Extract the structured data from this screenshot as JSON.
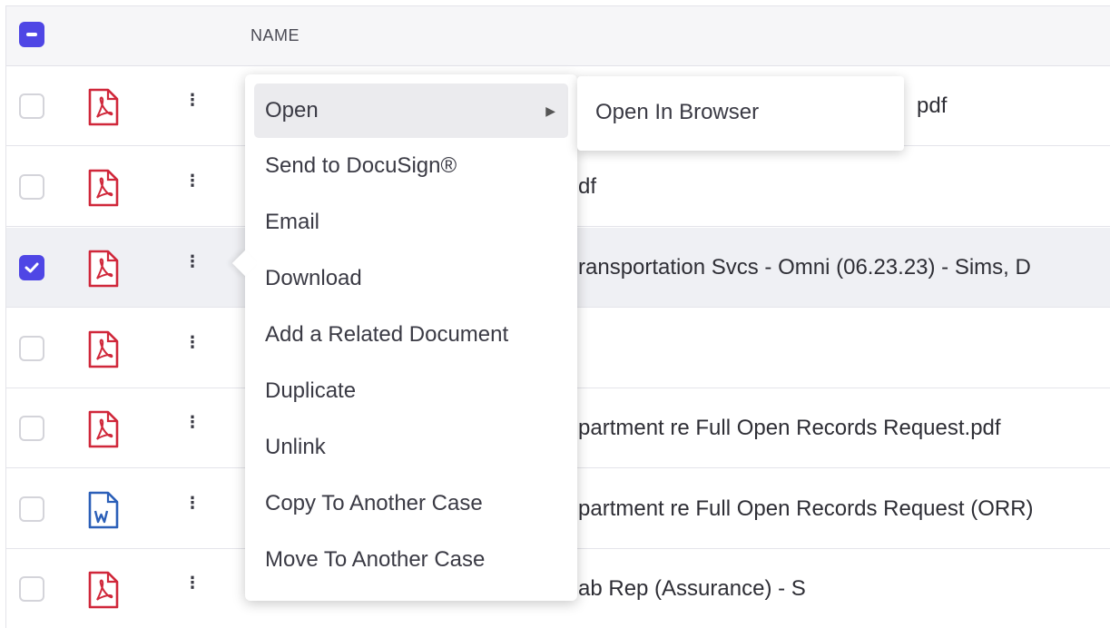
{
  "table": {
    "header": {
      "name_label": "NAME"
    },
    "rows": [
      {
        "type": "pdf",
        "checked": false,
        "name_visible": "pdf"
      },
      {
        "type": "pdf",
        "checked": false,
        "name_visible": "df"
      },
      {
        "type": "pdf",
        "checked": true,
        "name_visible": "ransportation Svcs - Omni (06.23.23) - Sims, D"
      },
      {
        "type": "pdf",
        "checked": false,
        "name_visible": ""
      },
      {
        "type": "pdf",
        "checked": false,
        "name_visible": "partment re Full Open Records Request.pdf"
      },
      {
        "type": "word",
        "checked": false,
        "name_visible": "partment re Full Open Records Request (ORR)"
      },
      {
        "type": "pdf",
        "checked": false,
        "name_visible": "ab Rep (Assurance) - S"
      }
    ]
  },
  "context_menu": {
    "items": [
      {
        "label": "Open",
        "has_submenu": true
      },
      {
        "label": "Send to DocuSign®"
      },
      {
        "label": "Email"
      },
      {
        "label": "Download"
      },
      {
        "label": "Add a Related Document"
      },
      {
        "label": "Duplicate"
      },
      {
        "label": "Unlink"
      },
      {
        "label": "Copy To Another Case"
      },
      {
        "label": "Move To Another Case"
      }
    ],
    "submenu": {
      "items": [
        {
          "label": "Open In Browser"
        }
      ]
    }
  },
  "icons": {
    "pdf": "pdf-file-icon",
    "word": "word-file-icon",
    "row_menu": "vertical-dots-icon",
    "submenu_arrow": "chevron-right-icon"
  },
  "colors": {
    "accent": "#4f46e5",
    "pdf_red": "#d0273a",
    "word_blue": "#2b5fb8"
  }
}
